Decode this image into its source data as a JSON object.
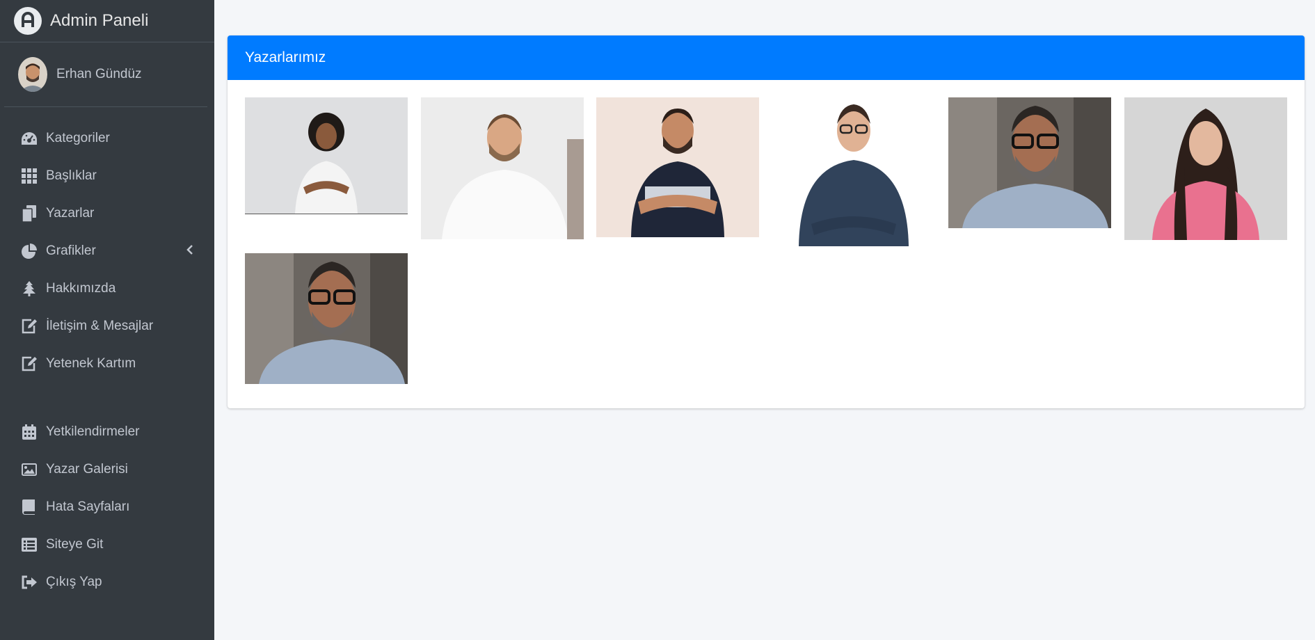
{
  "brand": {
    "title": "Admin Paneli"
  },
  "user": {
    "name": "Erhan Gündüz"
  },
  "nav": [
    {
      "label": "Kategoriler",
      "icon": "dashboard-gauge-icon"
    },
    {
      "label": "Başlıklar",
      "icon": "grid-icon"
    },
    {
      "label": "Yazarlar",
      "icon": "copy-icon"
    },
    {
      "label": "Grafikler",
      "icon": "pie-chart-icon"
    },
    {
      "label": "Hakkımızda",
      "icon": "tree-icon"
    },
    {
      "label": "İletişim & Mesajlar",
      "icon": "edit-icon"
    },
    {
      "label": "Yetenek Kartım",
      "icon": "edit-icon"
    },
    {
      "label": "Yetkilendirmeler",
      "icon": "calendar-icon"
    },
    {
      "label": "Yazar Galerisi",
      "icon": "image-icon"
    },
    {
      "label": "Hata Sayfaları",
      "icon": "book-icon"
    },
    {
      "label": "Siteye Git",
      "icon": "list-icon"
    },
    {
      "label": "Çıkış Yap",
      "icon": "sign-out-icon"
    }
  ],
  "card": {
    "title": "Yazarlarımız"
  },
  "colors": {
    "sidebar": "#343a40",
    "accent": "#007bff",
    "background": "#f4f6f9"
  }
}
